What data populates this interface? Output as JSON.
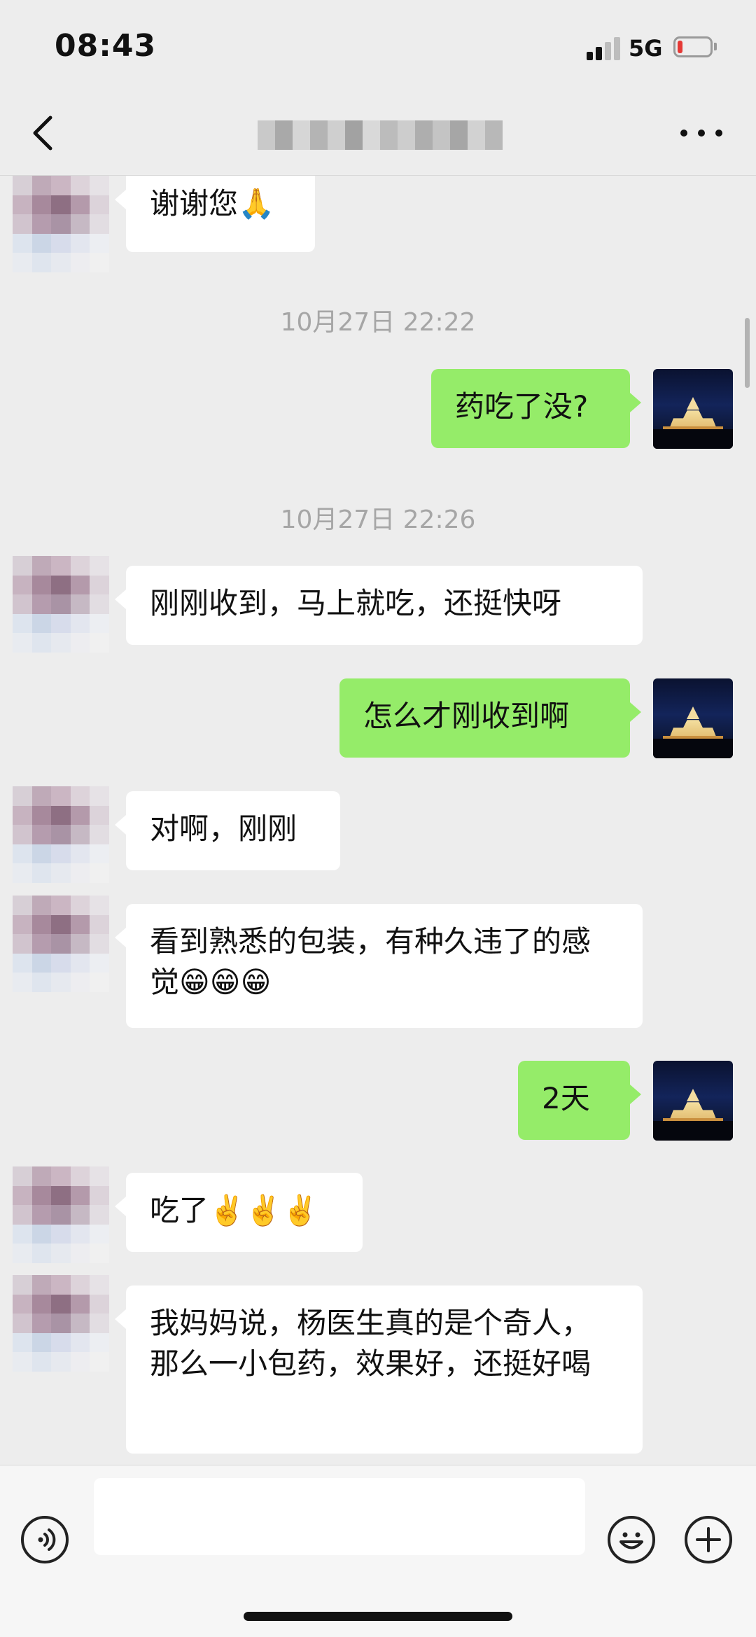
{
  "status_bar": {
    "time": "08:43",
    "network": "5G",
    "signal_bars_active": 2,
    "battery_level": 0.1
  },
  "nav": {
    "back_icon": "chevron-left-icon",
    "title_redacted": true,
    "more_icon": "more-dots-icon"
  },
  "colors": {
    "background": "#ededed",
    "bubble_in": "#ffffff",
    "bubble_out": "#95ec69",
    "timestamp": "#a6a6a6",
    "battery_low": "#e53935"
  },
  "messages": [
    {
      "side": "in",
      "text": "谢谢您🙏"
    },
    {
      "type": "timestamp",
      "text": "10月27日 22:22"
    },
    {
      "side": "out",
      "text": "药吃了没?"
    },
    {
      "type": "timestamp",
      "text": "10月27日 22:26"
    },
    {
      "side": "in",
      "text": "刚刚收到，马上就吃，还挺快呀"
    },
    {
      "side": "out",
      "text": "怎么才刚收到啊"
    },
    {
      "side": "in",
      "text": "对啊，刚刚"
    },
    {
      "side": "in",
      "text": "看到熟悉的包装，有种久违了的感觉😁😁😁"
    },
    {
      "side": "out",
      "text": "2天"
    },
    {
      "side": "in",
      "text": "吃了✌️✌️✌️"
    },
    {
      "side": "in",
      "text": "我妈妈说，杨医生真的是个奇人，那么一小包药，效果好，还挺好喝"
    }
  ],
  "input_bar": {
    "voice_icon": "voice-icon",
    "input_value": "",
    "emoji_icon": "emoji-icon",
    "plus_icon": "plus-icon"
  }
}
